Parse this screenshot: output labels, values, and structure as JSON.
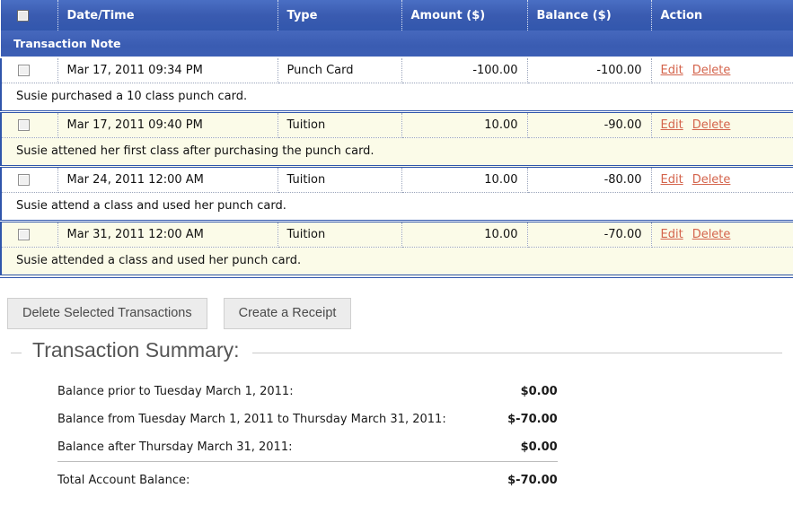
{
  "table": {
    "columns": [
      {
        "key": "check",
        "label": "",
        "icon": "select-all-checkbox"
      },
      {
        "key": "date",
        "label": "Date/Time"
      },
      {
        "key": "type",
        "label": "Type"
      },
      {
        "key": "amount",
        "label": "Amount ($)"
      },
      {
        "key": "balance",
        "label": "Balance ($)"
      },
      {
        "key": "action",
        "label": "Action"
      }
    ],
    "note_header": "Transaction Note",
    "edit_label": "Edit",
    "delete_label": "Delete",
    "rows": [
      {
        "date": "Mar 17, 2011 09:34 PM",
        "type": "Punch Card",
        "amount": "-100.00",
        "balance": "-100.00",
        "note": "Susie purchased a 10 class punch card.",
        "shade": "white"
      },
      {
        "date": "Mar 17, 2011 09:40 PM",
        "type": "Tuition",
        "amount": "10.00",
        "balance": "-90.00",
        "note": "Susie attened her first class after purchasing the punch card.",
        "shade": "cream"
      },
      {
        "date": "Mar 24, 2011 12:00 AM",
        "type": "Tuition",
        "amount": "10.00",
        "balance": "-80.00",
        "note": "Susie attend a class and used her punch card.",
        "shade": "white"
      },
      {
        "date": "Mar 31, 2011 12:00 AM",
        "type": "Tuition",
        "amount": "10.00",
        "balance": "-70.00",
        "note": "Susie attended a class and used her punch card.",
        "shade": "cream"
      }
    ]
  },
  "buttons": {
    "delete_selected": "Delete Selected Transactions",
    "create_receipt": "Create a Receipt"
  },
  "summary": {
    "legend": "Transaction Summary:",
    "lines": [
      {
        "label": "Balance prior to Tuesday March 1, 2011:",
        "value": "$0.00"
      },
      {
        "label": "Balance from Tuesday March 1, 2011 to Thursday March 31, 2011:",
        "value": "$-70.00"
      },
      {
        "label": "Balance after Thursday March 31, 2011:",
        "value": "$0.00"
      }
    ],
    "total_label": "Total Account Balance:",
    "total_value": "$-70.00"
  },
  "colors": {
    "header_blue": "#3a5bb0",
    "border_blue": "#2f55ab",
    "link_orange": "#d4644c",
    "row_cream": "#fbfbe8",
    "row_white": "#ffffff"
  }
}
